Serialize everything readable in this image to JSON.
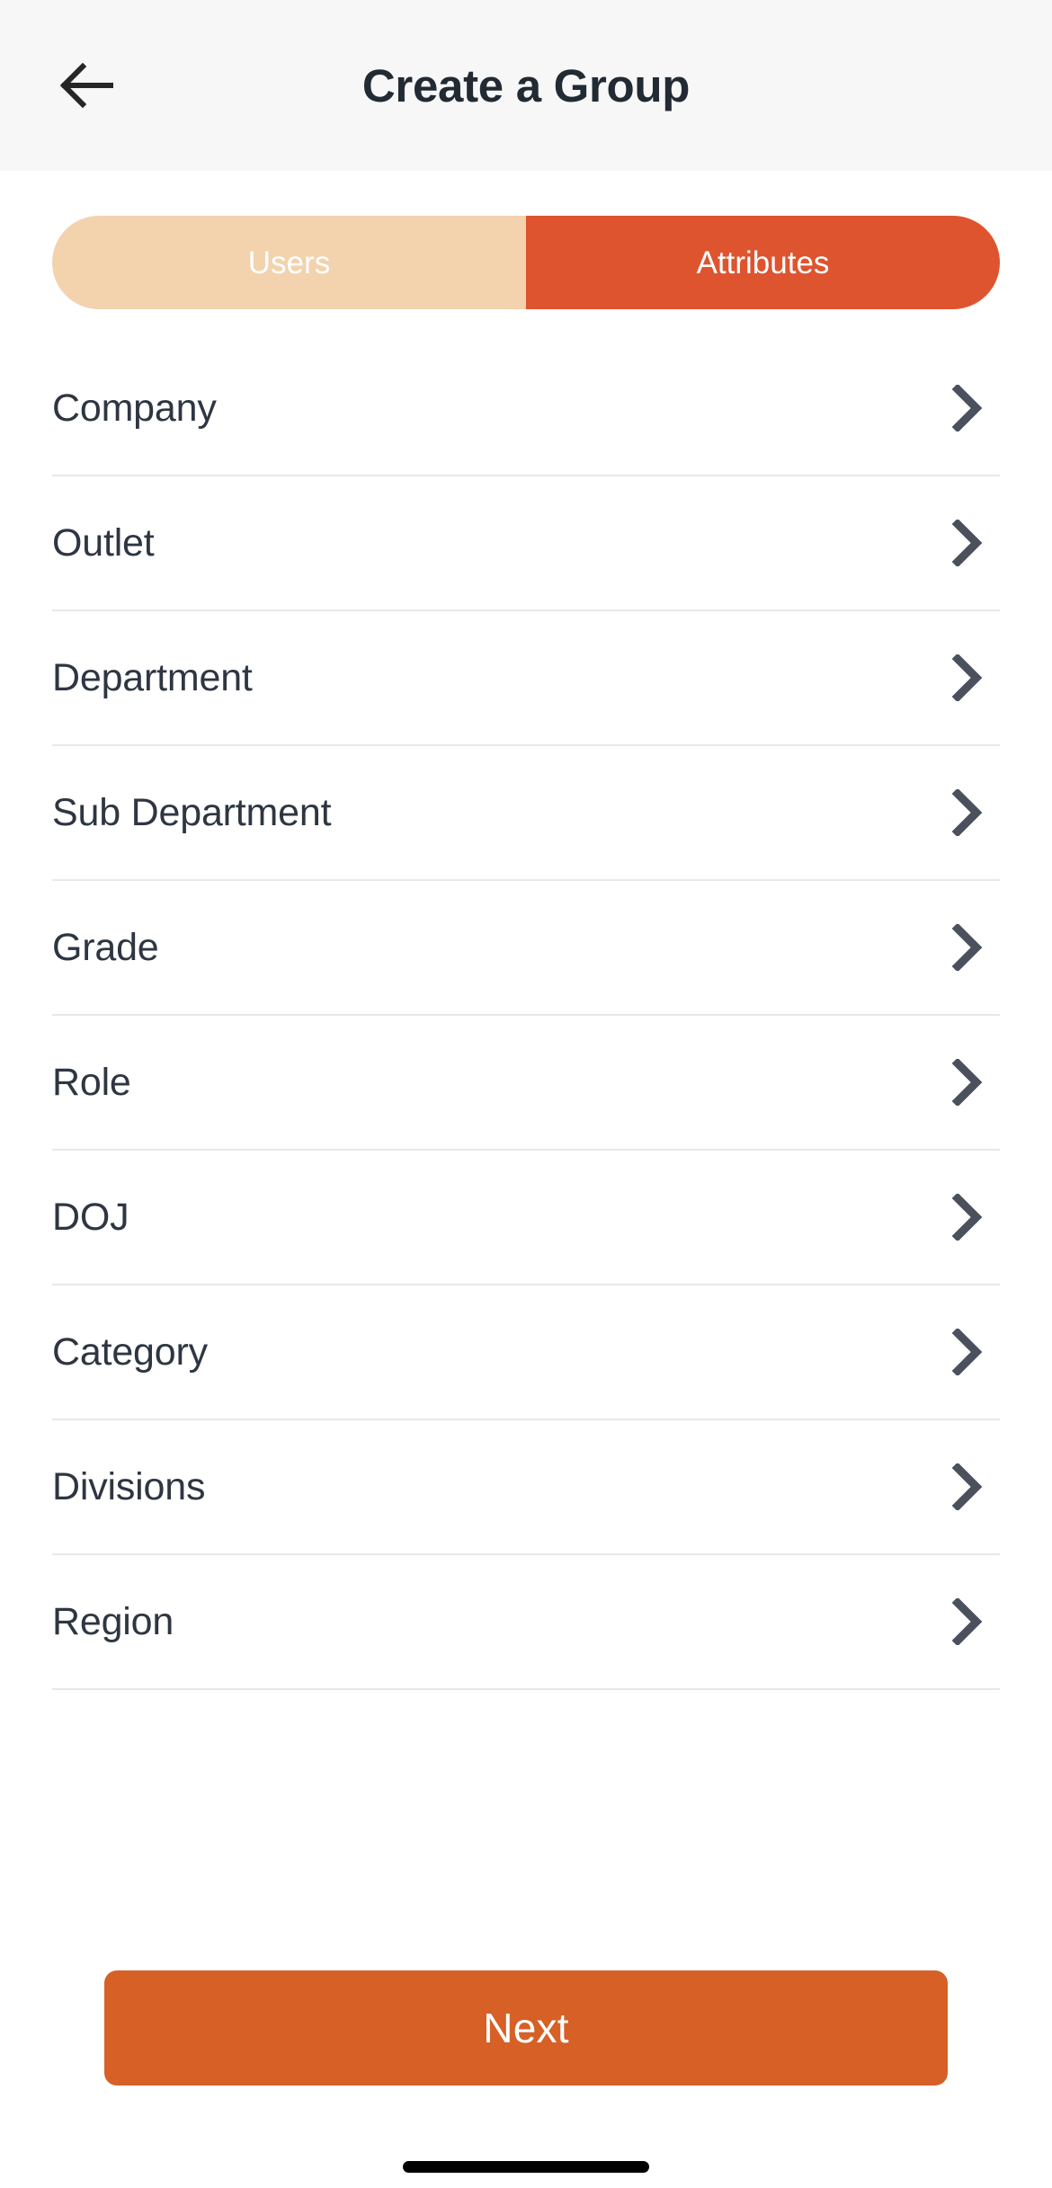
{
  "header": {
    "title": "Create a Group",
    "back_icon": "arrow-left-icon"
  },
  "segmented_control": {
    "options": [
      {
        "label": "Users",
        "active": false
      },
      {
        "label": "Attributes",
        "active": true
      }
    ],
    "active_color": "#DE542F",
    "inactive_color": "#F2D3AE",
    "label_color": "#FFFFFF"
  },
  "attributes_list": {
    "chevron_icon": "chevron-right-icon",
    "items": [
      {
        "label": "Company"
      },
      {
        "label": "Outlet"
      },
      {
        "label": "Department"
      },
      {
        "label": "Sub Department"
      },
      {
        "label": "Grade"
      },
      {
        "label": "Role"
      },
      {
        "label": "DOJ"
      },
      {
        "label": "Category"
      },
      {
        "label": "Divisions"
      },
      {
        "label": "Region"
      }
    ]
  },
  "footer": {
    "next_label": "Next",
    "next_color": "#D66026"
  }
}
